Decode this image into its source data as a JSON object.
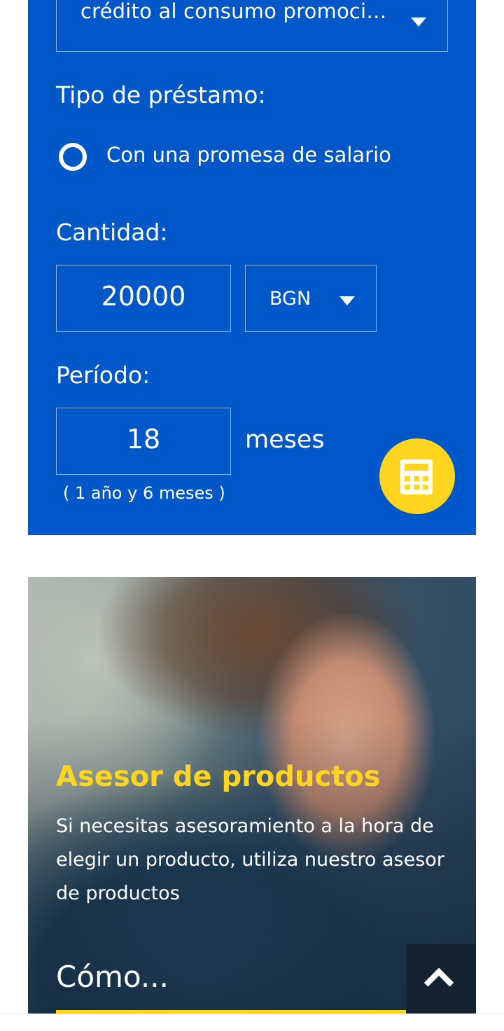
{
  "calculator": {
    "product_select": {
      "value": "crédito al consumo promoci…"
    },
    "loan_type": {
      "label": "Tipo de préstamo:",
      "option": "Con una promesa de salario",
      "option_selected": true
    },
    "amount": {
      "label": "Cantidad:",
      "value": "20000",
      "currency": "BGN"
    },
    "period": {
      "label": "Período:",
      "value": "18",
      "unit": "meses",
      "note": "( 1 año y 6 meses )"
    },
    "calc_button_icon": "calculator-icon"
  },
  "promo": {
    "title": "Asesor de productos",
    "description": "Si necesitas asesoramiento a la hora de elegir un producto, utiliza nuestro asesor de productos",
    "link": "Cómo..."
  },
  "scroll_top_icon": "chevron-up-icon",
  "colors": {
    "panel_blue": "#0057c8",
    "accent_yellow": "#ffd51f",
    "text_white": "#ffffff"
  }
}
